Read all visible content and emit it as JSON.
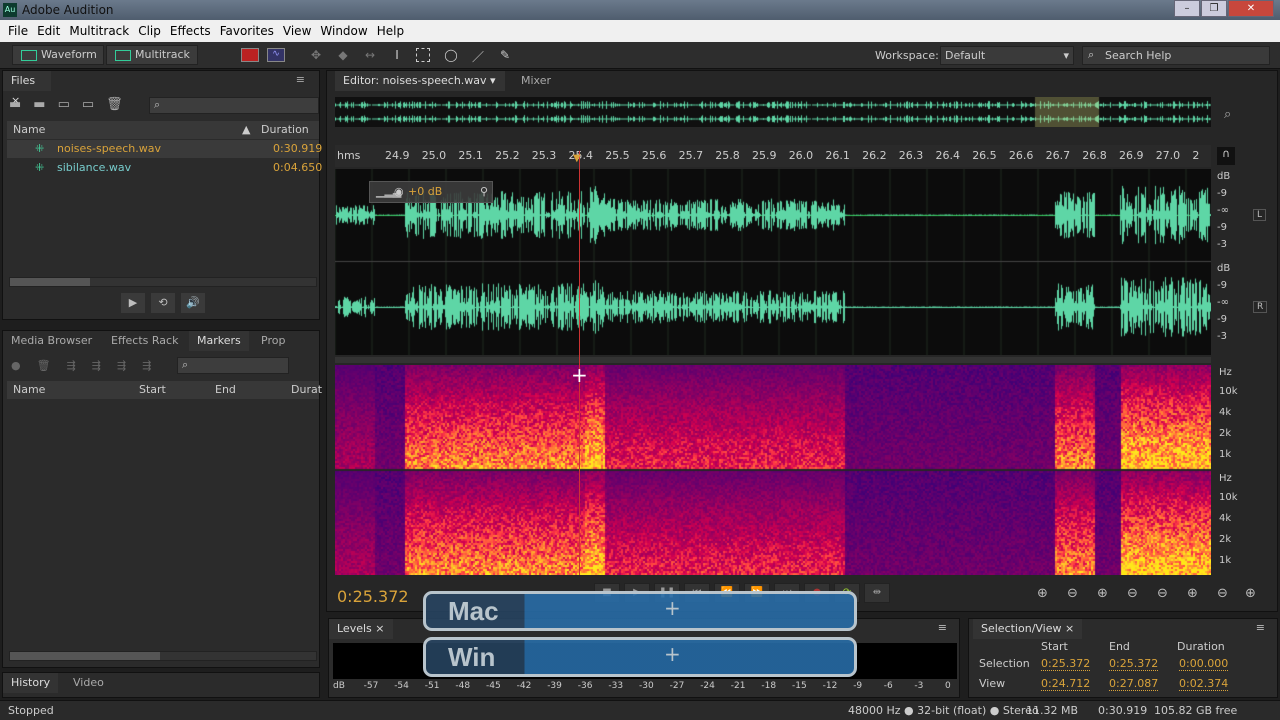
{
  "window": {
    "title": "Adobe Audition",
    "app_icon": "Au",
    "controls": [
      "minimize",
      "restore",
      "close"
    ]
  },
  "menu": [
    "File",
    "Edit",
    "Multitrack",
    "Clip",
    "Effects",
    "Favorites",
    "View",
    "Window",
    "Help"
  ],
  "toolbar": {
    "waveform": "Waveform",
    "multitrack": "Multitrack",
    "workspace_label": "Workspace:",
    "workspace_value": "Default",
    "search_placeholder": "Search Help"
  },
  "files": {
    "tab": "Files",
    "col_name": "Name",
    "col_duration": "Duration",
    "items": [
      {
        "name": "noises-speech.wav",
        "duration": "0:30.919"
      },
      {
        "name": "sibilance.wav",
        "duration": "0:04.650"
      }
    ]
  },
  "lower_tabs": [
    "Media Browser",
    "Effects Rack",
    "Markers",
    "Prop"
  ],
  "markers": {
    "cols": [
      "Name",
      "Start",
      "End",
      "Durat"
    ]
  },
  "history_tabs": [
    "History",
    "Video"
  ],
  "editor": {
    "tab": "Editor: noises-speech.wav",
    "mixer": "Mixer",
    "hud_gain": "+0 dB",
    "ruler": [
      "hms",
      "24.9",
      "25.0",
      "25.1",
      "25.2",
      "25.3",
      "25.4",
      "25.5",
      "25.6",
      "25.7",
      "25.8",
      "25.9",
      "26.0",
      "26.1",
      "26.2",
      "26.3",
      "26.4",
      "26.5",
      "26.6",
      "26.7",
      "26.8",
      "26.9",
      "27.0",
      "2"
    ],
    "db_scale": [
      "dB",
      "-9",
      "-∞",
      "-9",
      "-3"
    ],
    "channels": [
      "L",
      "R"
    ],
    "hz_scale": [
      "Hz",
      "10k",
      "4k",
      "2k",
      "1k"
    ],
    "time": "0:25.372"
  },
  "overlay": {
    "mac": "Mac",
    "win": "Win",
    "plus": "+"
  },
  "levels": {
    "tab": "Levels",
    "scale": [
      "dB",
      "-57",
      "-54",
      "-51",
      "-48",
      "-45",
      "-42",
      "-39",
      "-36",
      "-33",
      "-30",
      "-27",
      "-24",
      "-21",
      "-18",
      "-15",
      "-12",
      "-9",
      "-6",
      "-3",
      "0"
    ]
  },
  "selection_view": {
    "tab": "Selection/View",
    "cols": [
      "Start",
      "End",
      "Duration"
    ],
    "rows": [
      {
        "label": "Selection",
        "start": "0:25.372",
        "end": "0:25.372",
        "duration": "0:00.000"
      },
      {
        "label": "View",
        "start": "0:24.712",
        "end": "0:27.087",
        "duration": "0:02.374"
      }
    ]
  },
  "status": {
    "left": "Stopped",
    "format": "48000 Hz ● 32-bit (float) ● Stereo",
    "size": "11.32 MB",
    "duration": "0:30.919",
    "free": "105.82 GB free"
  }
}
